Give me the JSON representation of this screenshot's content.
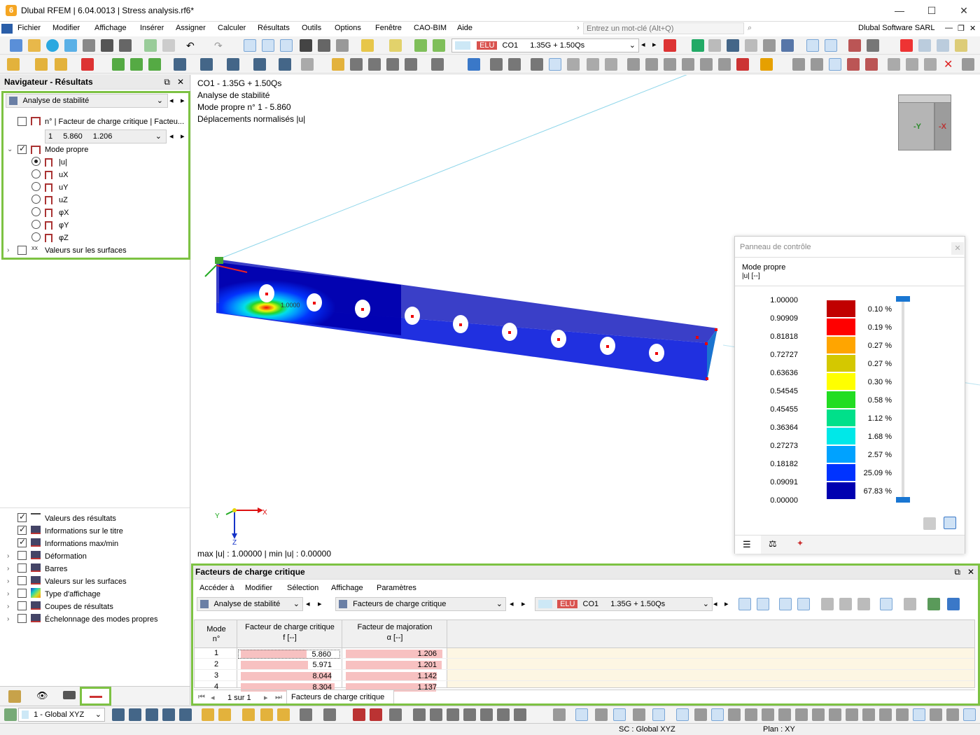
{
  "window": {
    "title": "Dlubal RFEM | 6.04.0013 | Stress analysis.rf6*",
    "minimize": "—",
    "maximize": "☐",
    "close": "✕"
  },
  "menu": {
    "items": [
      "Fichier",
      "Modifier",
      "Affichage",
      "Insérer",
      "Assigner",
      "Calculer",
      "Résultats",
      "Outils",
      "Options",
      "Fenêtre",
      "CAO-BIM",
      "Aide"
    ],
    "search_placeholder": "Entrez un mot-clé (Alt+Q)",
    "company": "Dlubal Software SARL"
  },
  "toolbar": {
    "elu_badge": "ELU",
    "co_label": "CO1",
    "combo_text": "1.35G + 1.50Qs"
  },
  "navigator": {
    "title": "Navigateur - Résultats",
    "analysis_select": "Analyse de stabilité",
    "factor_row": "n° | Facteur de charge critique | Facteu...",
    "mode_select": {
      "n": "1",
      "f": "5.860",
      "alpha": "1.206"
    },
    "mode_propre_label": "Mode propre",
    "modes": [
      "|u|",
      "uX",
      "uY",
      "uZ",
      "φX",
      "φY",
      "φZ"
    ],
    "surface_values": "Valeurs sur les surfaces",
    "bottom_items": [
      {
        "label": "Valeurs des résultats",
        "checked": true
      },
      {
        "label": "Informations sur le titre",
        "checked": true
      },
      {
        "label": "Informations max/min",
        "checked": true
      },
      {
        "label": "Déformation",
        "checked": false
      },
      {
        "label": "Barres",
        "checked": false
      },
      {
        "label": "Valeurs sur les surfaces",
        "checked": false
      },
      {
        "label": "Type d'affichage",
        "checked": false
      },
      {
        "label": "Coupes de résultats",
        "checked": false
      },
      {
        "label": "Échelonnage des modes propres",
        "checked": false
      }
    ]
  },
  "viewport": {
    "info_lines": [
      "CO1 - 1.35G + 1.50Qs",
      "Analyse de stabilité",
      "Mode propre n° 1 - 5.860",
      "Déplacements normalisés |u|"
    ],
    "maxmin": "max |u| : 1.00000 | min |u| : 0.00000",
    "axis_x": "X",
    "axis_y": "Y",
    "axis_z": "Z",
    "cube_y": "-Y",
    "cube_x": "-X",
    "beam_label": "1.0000"
  },
  "control_panel": {
    "title": "Panneau de contrôle",
    "subtitle1": "Mode propre",
    "subtitle2": "|u| [--]",
    "values": [
      "1.00000",
      "0.90909",
      "0.81818",
      "0.72727",
      "0.63636",
      "0.54545",
      "0.45455",
      "0.36364",
      "0.27273",
      "0.18182",
      "0.09091",
      "0.00000"
    ],
    "colors": [
      "#c00000",
      "#ff0000",
      "#ffa500",
      "#d4c800",
      "#ffff00",
      "#22dd22",
      "#00e08a",
      "#00e8e8",
      "#00a2ff",
      "#0033ff",
      "#0000b0"
    ],
    "percentages": [
      "0.10 %",
      "0.19 %",
      "0.27 %",
      "0.27 %",
      "0.30 %",
      "0.58 %",
      "1.12 %",
      "1.68 %",
      "2.57 %",
      "25.09 %",
      "67.83 %"
    ]
  },
  "table_panel": {
    "title": "Facteurs de charge critique",
    "menu": [
      "Accéder à",
      "Modifier",
      "Sélection",
      "Affichage",
      "Paramètres"
    ],
    "analysis_select": "Analyse de stabilité",
    "table_select": "Facteurs de charge critique",
    "elu_badge": "ELU",
    "co_label": "CO1",
    "combo_text": "1.35G + 1.50Qs",
    "headers": {
      "mode1": "Mode",
      "mode2": "n°",
      "f1": "Facteur de charge critique",
      "f2": "f [--]",
      "a1": "Facteur de majoration",
      "a2": "α [--]"
    },
    "rows": [
      {
        "mode": "1",
        "f": "5.860",
        "alpha": "1.206"
      },
      {
        "mode": "2",
        "f": "5.971",
        "alpha": "1.201"
      },
      {
        "mode": "3",
        "f": "8.044",
        "alpha": "1.142"
      },
      {
        "mode": "4",
        "f": "8.304",
        "alpha": "1.137"
      }
    ],
    "pager": "1 sur 1",
    "tab": "Facteurs de charge critique"
  },
  "statusbar": {
    "coord_system": "1 - Global XYZ",
    "sc": "SC : Global XYZ",
    "plan": "Plan : XY"
  }
}
